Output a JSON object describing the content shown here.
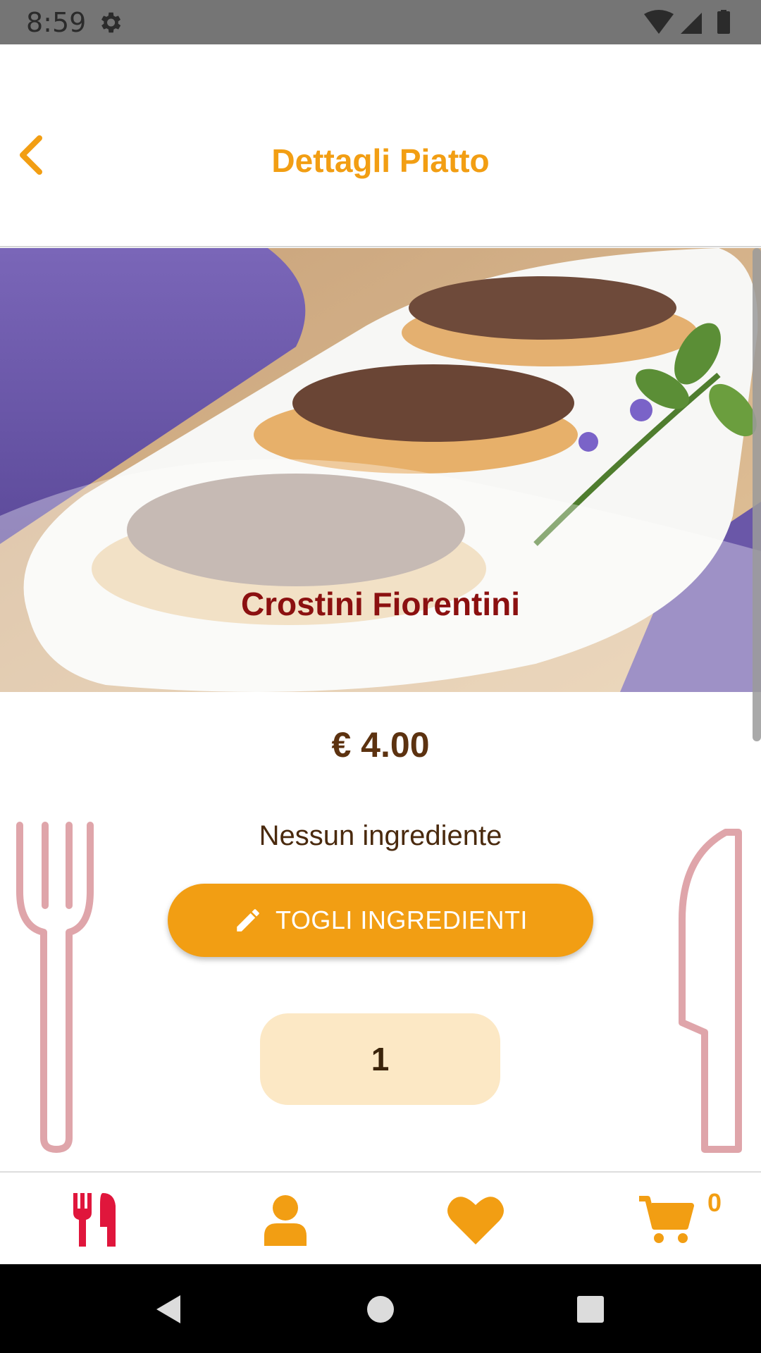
{
  "status_bar": {
    "time": "8:59",
    "icons": [
      "gear-icon",
      "wifi-icon",
      "signal-icon",
      "battery-icon"
    ]
  },
  "header": {
    "title": "Dettagli Piatto",
    "back_icon": "chevron-left-icon"
  },
  "dish": {
    "name": "Crostini Fiorentini",
    "price": "€ 4.00",
    "ingredients_text": "Nessun ingrediente",
    "remove_button_label": "TOGLI INGREDIENTI",
    "quantity": "1"
  },
  "bottom_nav": {
    "items": [
      {
        "icon": "utensils-icon",
        "active": true
      },
      {
        "icon": "user-icon",
        "active": false
      },
      {
        "icon": "heart-icon",
        "active": false
      },
      {
        "icon": "cart-icon",
        "active": false
      }
    ],
    "cart_count": "0"
  },
  "colors": {
    "accent": "#f29e13",
    "active": "#e0163c",
    "dish_name": "#8b1010",
    "price": "#5c3210",
    "quantity_bg": "#fce8c5",
    "decor": "#d9959b"
  }
}
